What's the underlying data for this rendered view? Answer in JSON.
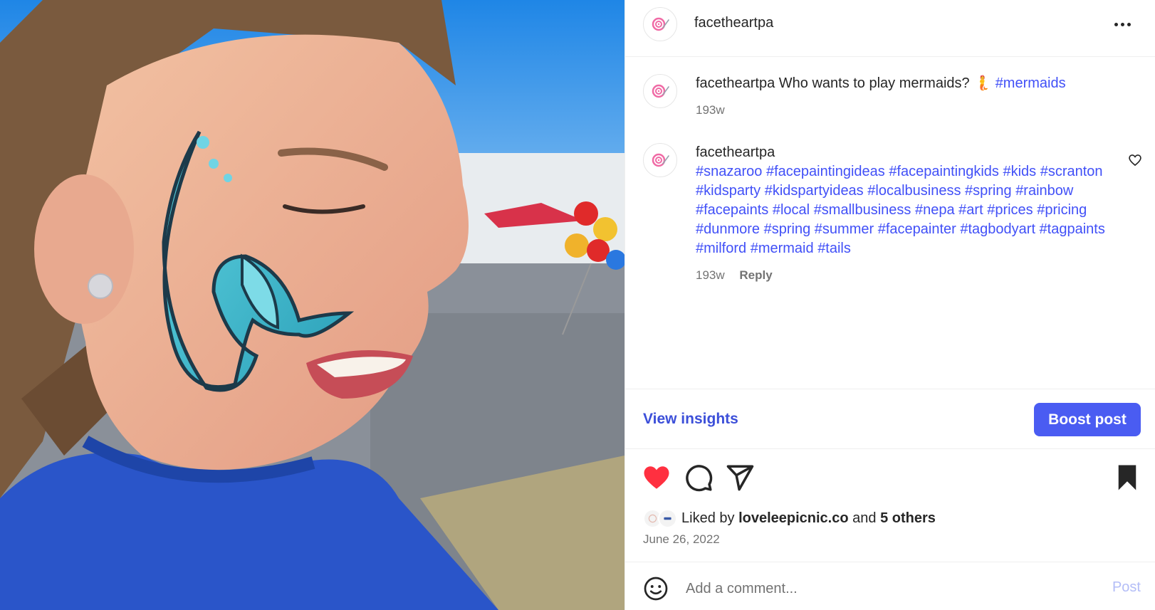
{
  "post": {
    "username": "facetheartpa",
    "more_icon": "more-horizontal-icon"
  },
  "caption": {
    "username": "facetheartpa",
    "text": "Who wants to play mermaids?",
    "emoji": "🧜",
    "hashtag": "#mermaids",
    "age": "193w"
  },
  "comment": {
    "username": "facetheartpa",
    "hashtags": [
      "#snazaroo",
      "#facepaintingideas",
      "#facepaintingkids",
      "#kids",
      "#scranton",
      "#kidsparty",
      "#kidspartyideas",
      "#localbusiness",
      "#spring",
      "#rainbow",
      "#facepaints",
      "#local",
      "#smallbusiness",
      "#nepa",
      "#art",
      "#prices",
      "#pricing",
      "#dunmore",
      "#spring",
      "#summer",
      "#facepainter",
      "#tagbodyart",
      "#tagpaints",
      "#milford",
      "#mermaid",
      "#tails"
    ],
    "age": "193w",
    "reply_label": "Reply"
  },
  "insights": {
    "view_label": "View insights",
    "boost_label": "Boost post"
  },
  "likes": {
    "prefix": "Liked by",
    "user": "loveleepicnic.co",
    "conj": "and",
    "others": "5 others"
  },
  "date": "June 26, 2022",
  "comment_box": {
    "placeholder": "Add a comment...",
    "post_label": "Post"
  },
  "colors": {
    "link": "#4150f7",
    "boost_bg": "#4a5cf2",
    "like_red": "#ff3040",
    "muted": "#737373"
  }
}
